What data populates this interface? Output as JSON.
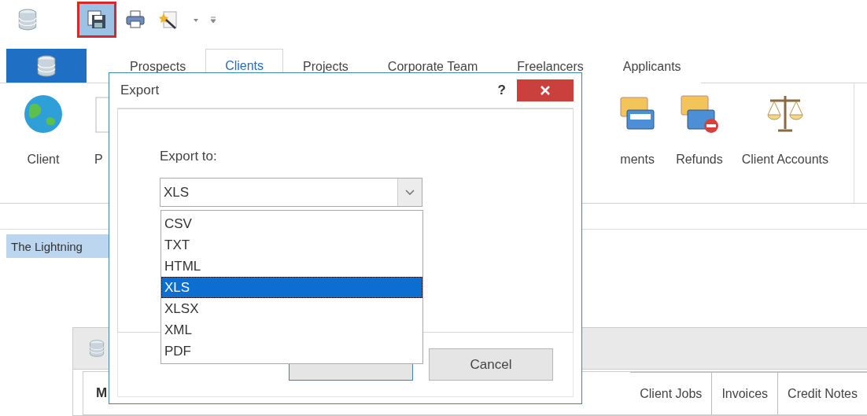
{
  "quick_access": [
    {
      "kind": "save",
      "highlighted": true
    },
    {
      "kind": "print",
      "highlighted": false
    },
    {
      "kind": "wizard",
      "highlighted": false
    }
  ],
  "ribbon_tabs": [
    {
      "label": "Prospects",
      "selected": false
    },
    {
      "label": "Clients",
      "selected": true
    },
    {
      "label": "Projects",
      "selected": false
    },
    {
      "label": "Corporate Team",
      "selected": false
    },
    {
      "label": "Freelancers",
      "selected": false
    },
    {
      "label": "Applicants",
      "selected": false
    }
  ],
  "ribbon_left": [
    {
      "label": "Client",
      "kind": "globe"
    },
    {
      "label": "P",
      "kind": "page"
    }
  ],
  "ribbon_right": [
    {
      "label": "ments",
      "kind": "cards"
    },
    {
      "label": "Refunds",
      "kind": "refund"
    },
    {
      "label": "Client Accounts",
      "kind": "scales"
    }
  ],
  "document_tab": {
    "label": "The Lightning",
    "selected": true
  },
  "inner_window": {
    "heading": "M",
    "tabs": [
      {
        "label": "Client Jobs",
        "selected": false
      },
      {
        "label": "Invoices",
        "selected": false
      },
      {
        "label": "Credit Notes",
        "selected": false
      }
    ]
  },
  "dialog": {
    "title": "Export",
    "help": "?",
    "field_label": "Export to:",
    "value": "XLS",
    "options": [
      {
        "label": "CSV",
        "selected": false
      },
      {
        "label": "TXT",
        "selected": false
      },
      {
        "label": "HTML",
        "selected": false
      },
      {
        "label": "XLS",
        "selected": true
      },
      {
        "label": "XLSX",
        "selected": false
      },
      {
        "label": "XML",
        "selected": false
      },
      {
        "label": "PDF",
        "selected": false
      }
    ],
    "cancel": "Cancel"
  }
}
